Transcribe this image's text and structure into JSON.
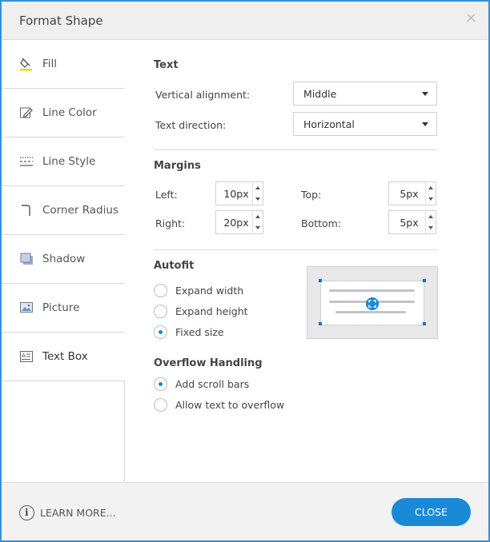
{
  "dialog": {
    "title": "Format Shape",
    "close_icon": "×"
  },
  "sidebar": {
    "items": [
      {
        "label": "Fill",
        "icon": "paint-bucket-icon"
      },
      {
        "label": "Line Color",
        "icon": "pencil-icon"
      },
      {
        "label": "Line Style",
        "icon": "line-style-icon"
      },
      {
        "label": "Corner Radius",
        "icon": "corner-radius-icon"
      },
      {
        "label": "Shadow",
        "icon": "shadow-icon"
      },
      {
        "label": "Picture",
        "icon": "picture-icon"
      },
      {
        "label": "Text Box",
        "icon": "text-box-icon",
        "active": true
      }
    ]
  },
  "text_section": {
    "title": "Text",
    "vertical_alignment": {
      "label": "Vertical alignment:",
      "value": "Middle"
    },
    "text_direction": {
      "label": "Text direction:",
      "value": "Horizontal"
    }
  },
  "margins": {
    "title": "Margins",
    "left": {
      "label": "Left:",
      "value": "10px"
    },
    "top": {
      "label": "Top:",
      "value": "5px"
    },
    "right": {
      "label": "Right:",
      "value": "20px"
    },
    "bottom": {
      "label": "Bottom:",
      "value": "5px"
    }
  },
  "autofit": {
    "title": "Autofit",
    "options": [
      {
        "label": "Expand width",
        "checked": false
      },
      {
        "label": "Expand height",
        "checked": false
      },
      {
        "label": "Fixed size",
        "checked": true
      }
    ]
  },
  "overflow": {
    "title": "Overflow Handling",
    "options": [
      {
        "label": "Add scroll bars",
        "checked": true
      },
      {
        "label": "Allow text to overflow",
        "checked": false
      }
    ]
  },
  "footer": {
    "learn_more": "LEARN MORE...",
    "close_label": "CLOSE"
  },
  "colors": {
    "accent": "#1a8ad6",
    "border": "#3a8fd6"
  }
}
